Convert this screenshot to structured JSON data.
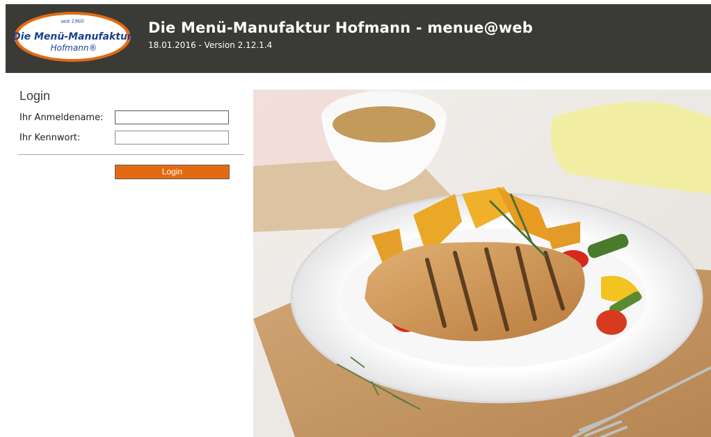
{
  "header": {
    "logo": {
      "tagline": "seit 1960",
      "line1": "Die Menü-Manufaktur",
      "line2": "Hofmann®"
    },
    "title": "Die Menü-Manufaktur Hofmann - menue@web",
    "subtitle": "18.01.2016 - Version 2.12.1.4"
  },
  "login": {
    "heading": "Login",
    "username_label": "Ihr Anmeldename:",
    "username_value": "",
    "password_label": "Ihr Kennwort:",
    "password_value": "",
    "button_label": "Login"
  },
  "colors": {
    "header_bg": "#3a3b37",
    "brand_orange": "#e46a12",
    "logo_blue": "#1b3f8f"
  },
  "icons": {
    "food": "grilled-chicken-plate-photo"
  }
}
